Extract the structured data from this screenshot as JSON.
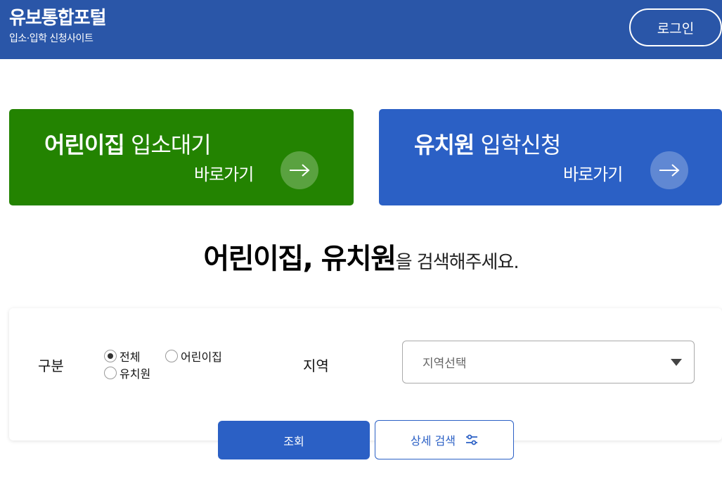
{
  "header": {
    "title": "유보통합포털",
    "subtitle": "입소·입학 신청사이트",
    "login_label": "로그인"
  },
  "cards": {
    "daycare": {
      "title_bold": "어린이집",
      "title_light": " 입소대기",
      "go_label": "바로가기",
      "color": "#238301"
    },
    "kinder": {
      "title_bold": "유치원",
      "title_light": " 입학신청",
      "go_label": "바로가기",
      "color": "#2b60c5"
    }
  },
  "headline": {
    "strong": "어린이집, 유치원",
    "rest": "을 검색해주세요."
  },
  "search": {
    "type_label": "구분",
    "options": [
      "전체",
      "어린이집",
      "유치원"
    ],
    "selected": "전체",
    "region_label": "지역",
    "region_value": "지역선택",
    "submit_label": "조회",
    "detail_label": "상세 검색"
  },
  "icons": {
    "arrow": "arrow-right-icon",
    "caret": "caret-down-icon",
    "filter": "sliders-icon"
  },
  "colors": {
    "header_bg": "#2a56a8",
    "accent_blue": "#2b60c5",
    "accent_green": "#238301"
  }
}
